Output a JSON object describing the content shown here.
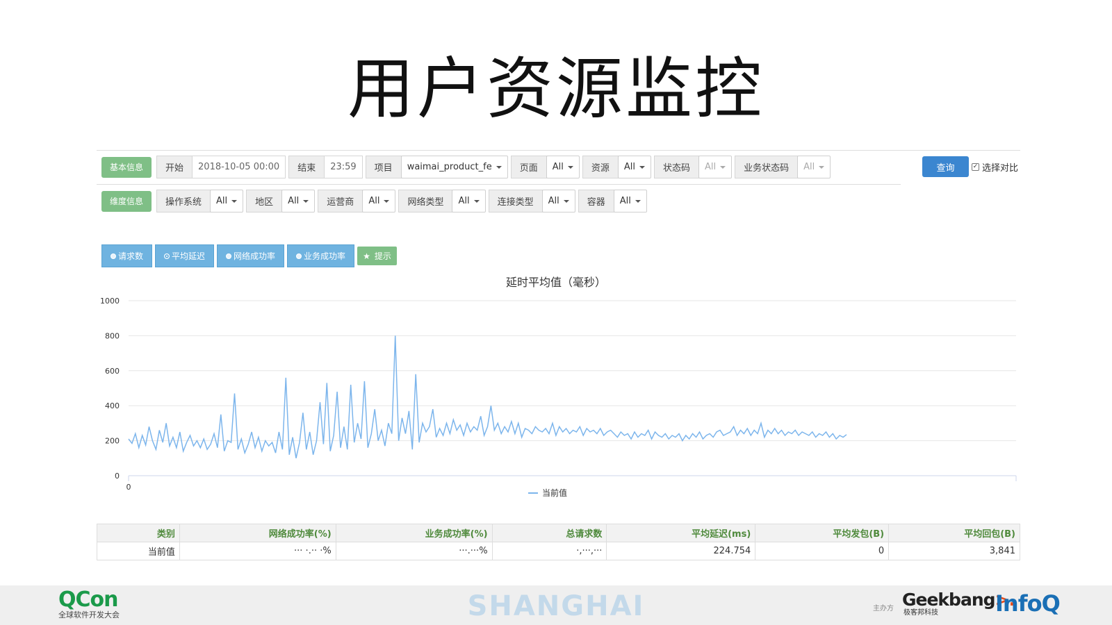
{
  "page": {
    "title": "用户资源监控"
  },
  "filters_row1": {
    "section_button": "基本信息",
    "start_label": "开始",
    "start_value": "2018-10-05 00:00",
    "end_label": "结束",
    "end_value": "23:59",
    "project_label": "项目",
    "project_value": "waimai_product_fe",
    "page_label": "页面",
    "page_value": "All",
    "resource_label": "资源",
    "resource_value": "All",
    "status_label": "状态码",
    "status_value": "All",
    "biz_status_label": "业务状态码",
    "biz_status_value": "All",
    "query_button": "查询",
    "compare_label": "选择对比",
    "compare_checked": "✓"
  },
  "filters_row2": {
    "section_button": "维度信息",
    "os_label": "操作系统",
    "os_value": "All",
    "region_label": "地区",
    "region_value": "All",
    "carrier_label": "运营商",
    "carrier_value": "All",
    "network_label": "网络类型",
    "network_value": "All",
    "conn_label": "连接类型",
    "conn_value": "All",
    "container_label": "容器",
    "container_value": "All"
  },
  "metric_tabs": {
    "requests": "请求数",
    "avg_latency": "平均延迟",
    "net_success": "网络成功率",
    "biz_success": "业务成功率",
    "hint": "提示",
    "hint_icon": "star-icon",
    "active": "avg_latency"
  },
  "chart_data": {
    "type": "line",
    "title": "延时平均值（毫秒）",
    "xlabel": "",
    "ylabel": "",
    "ylim": [
      0,
      1000
    ],
    "yticks": [
      "0",
      "200",
      "400",
      "600",
      "800",
      "1000"
    ],
    "xticks": [
      "0"
    ],
    "legend_position": "bottom-center",
    "grid": true,
    "color": "#7cb5ec",
    "series": [
      {
        "name": "当前值",
        "values": [
          210,
          185,
          240,
          160,
          230,
          175,
          280,
          200,
          150,
          260,
          190,
          300,
          170,
          220,
          160,
          250,
          140,
          190,
          230,
          170,
          200,
          160,
          210,
          150,
          180,
          240,
          160,
          350,
          140,
          200,
          190,
          470,
          150,
          210,
          130,
          180,
          250,
          160,
          220,
          140,
          200,
          170,
          190,
          130,
          250,
          150,
          560,
          120,
          220,
          100,
          190,
          360,
          150,
          250,
          120,
          200,
          420,
          180,
          530,
          140,
          230,
          480,
          160,
          280,
          150,
          520,
          190,
          300,
          210,
          540,
          160,
          240,
          380,
          200,
          260,
          170,
          300,
          240,
          800,
          200,
          330,
          240,
          370,
          150,
          580,
          190,
          300,
          250,
          280,
          380,
          220,
          270,
          230,
          300,
          240,
          320,
          260,
          290,
          230,
          300,
          250,
          280,
          260,
          340,
          230,
          280,
          400,
          260,
          300,
          240,
          280,
          250,
          310,
          240,
          300,
          220,
          270,
          260,
          240,
          280,
          260,
          250,
          270,
          240,
          300,
          230,
          280,
          250,
          270,
          240,
          260,
          250,
          280,
          230,
          270,
          250,
          260,
          240,
          270,
          230,
          250,
          260,
          240,
          220,
          250,
          230,
          240,
          210,
          250,
          220,
          240,
          230,
          260,
          210,
          250,
          230,
          220,
          240,
          210,
          230,
          220,
          240,
          200,
          230,
          210,
          240,
          220,
          250,
          210,
          230,
          240,
          220,
          250,
          260,
          230,
          240,
          250,
          280,
          230,
          260,
          240,
          270,
          230,
          260,
          240,
          300,
          220,
          260,
          240,
          270,
          240,
          260,
          230,
          250,
          240,
          260,
          230,
          250,
          240,
          230,
          250,
          220,
          240,
          230,
          250,
          220,
          240,
          210,
          230,
          220,
          235
        ]
      }
    ]
  },
  "table": {
    "headers": [
      "类别",
      "网络成功率(%)",
      "业务成功率(%)",
      "总请求数",
      "平均延迟(ms)",
      "平均发包(B)",
      "平均回包(B)"
    ],
    "rows": [
      [
        "当前值",
        "··· ·.·· ·%",
        "···.···%",
        "·,···,···",
        "224.754",
        "0",
        "3,841"
      ]
    ]
  },
  "footer": {
    "brand_left": "QCon",
    "brand_left_sub": "全球软件开发大会",
    "city": "SHANGHAI",
    "sponsor_label": "主办方",
    "sponsor_brand": "Geekbang",
    "sponsor_arrow": ">.",
    "sponsor_sub": "极客邦科技",
    "brand_right": "InfoQ"
  }
}
